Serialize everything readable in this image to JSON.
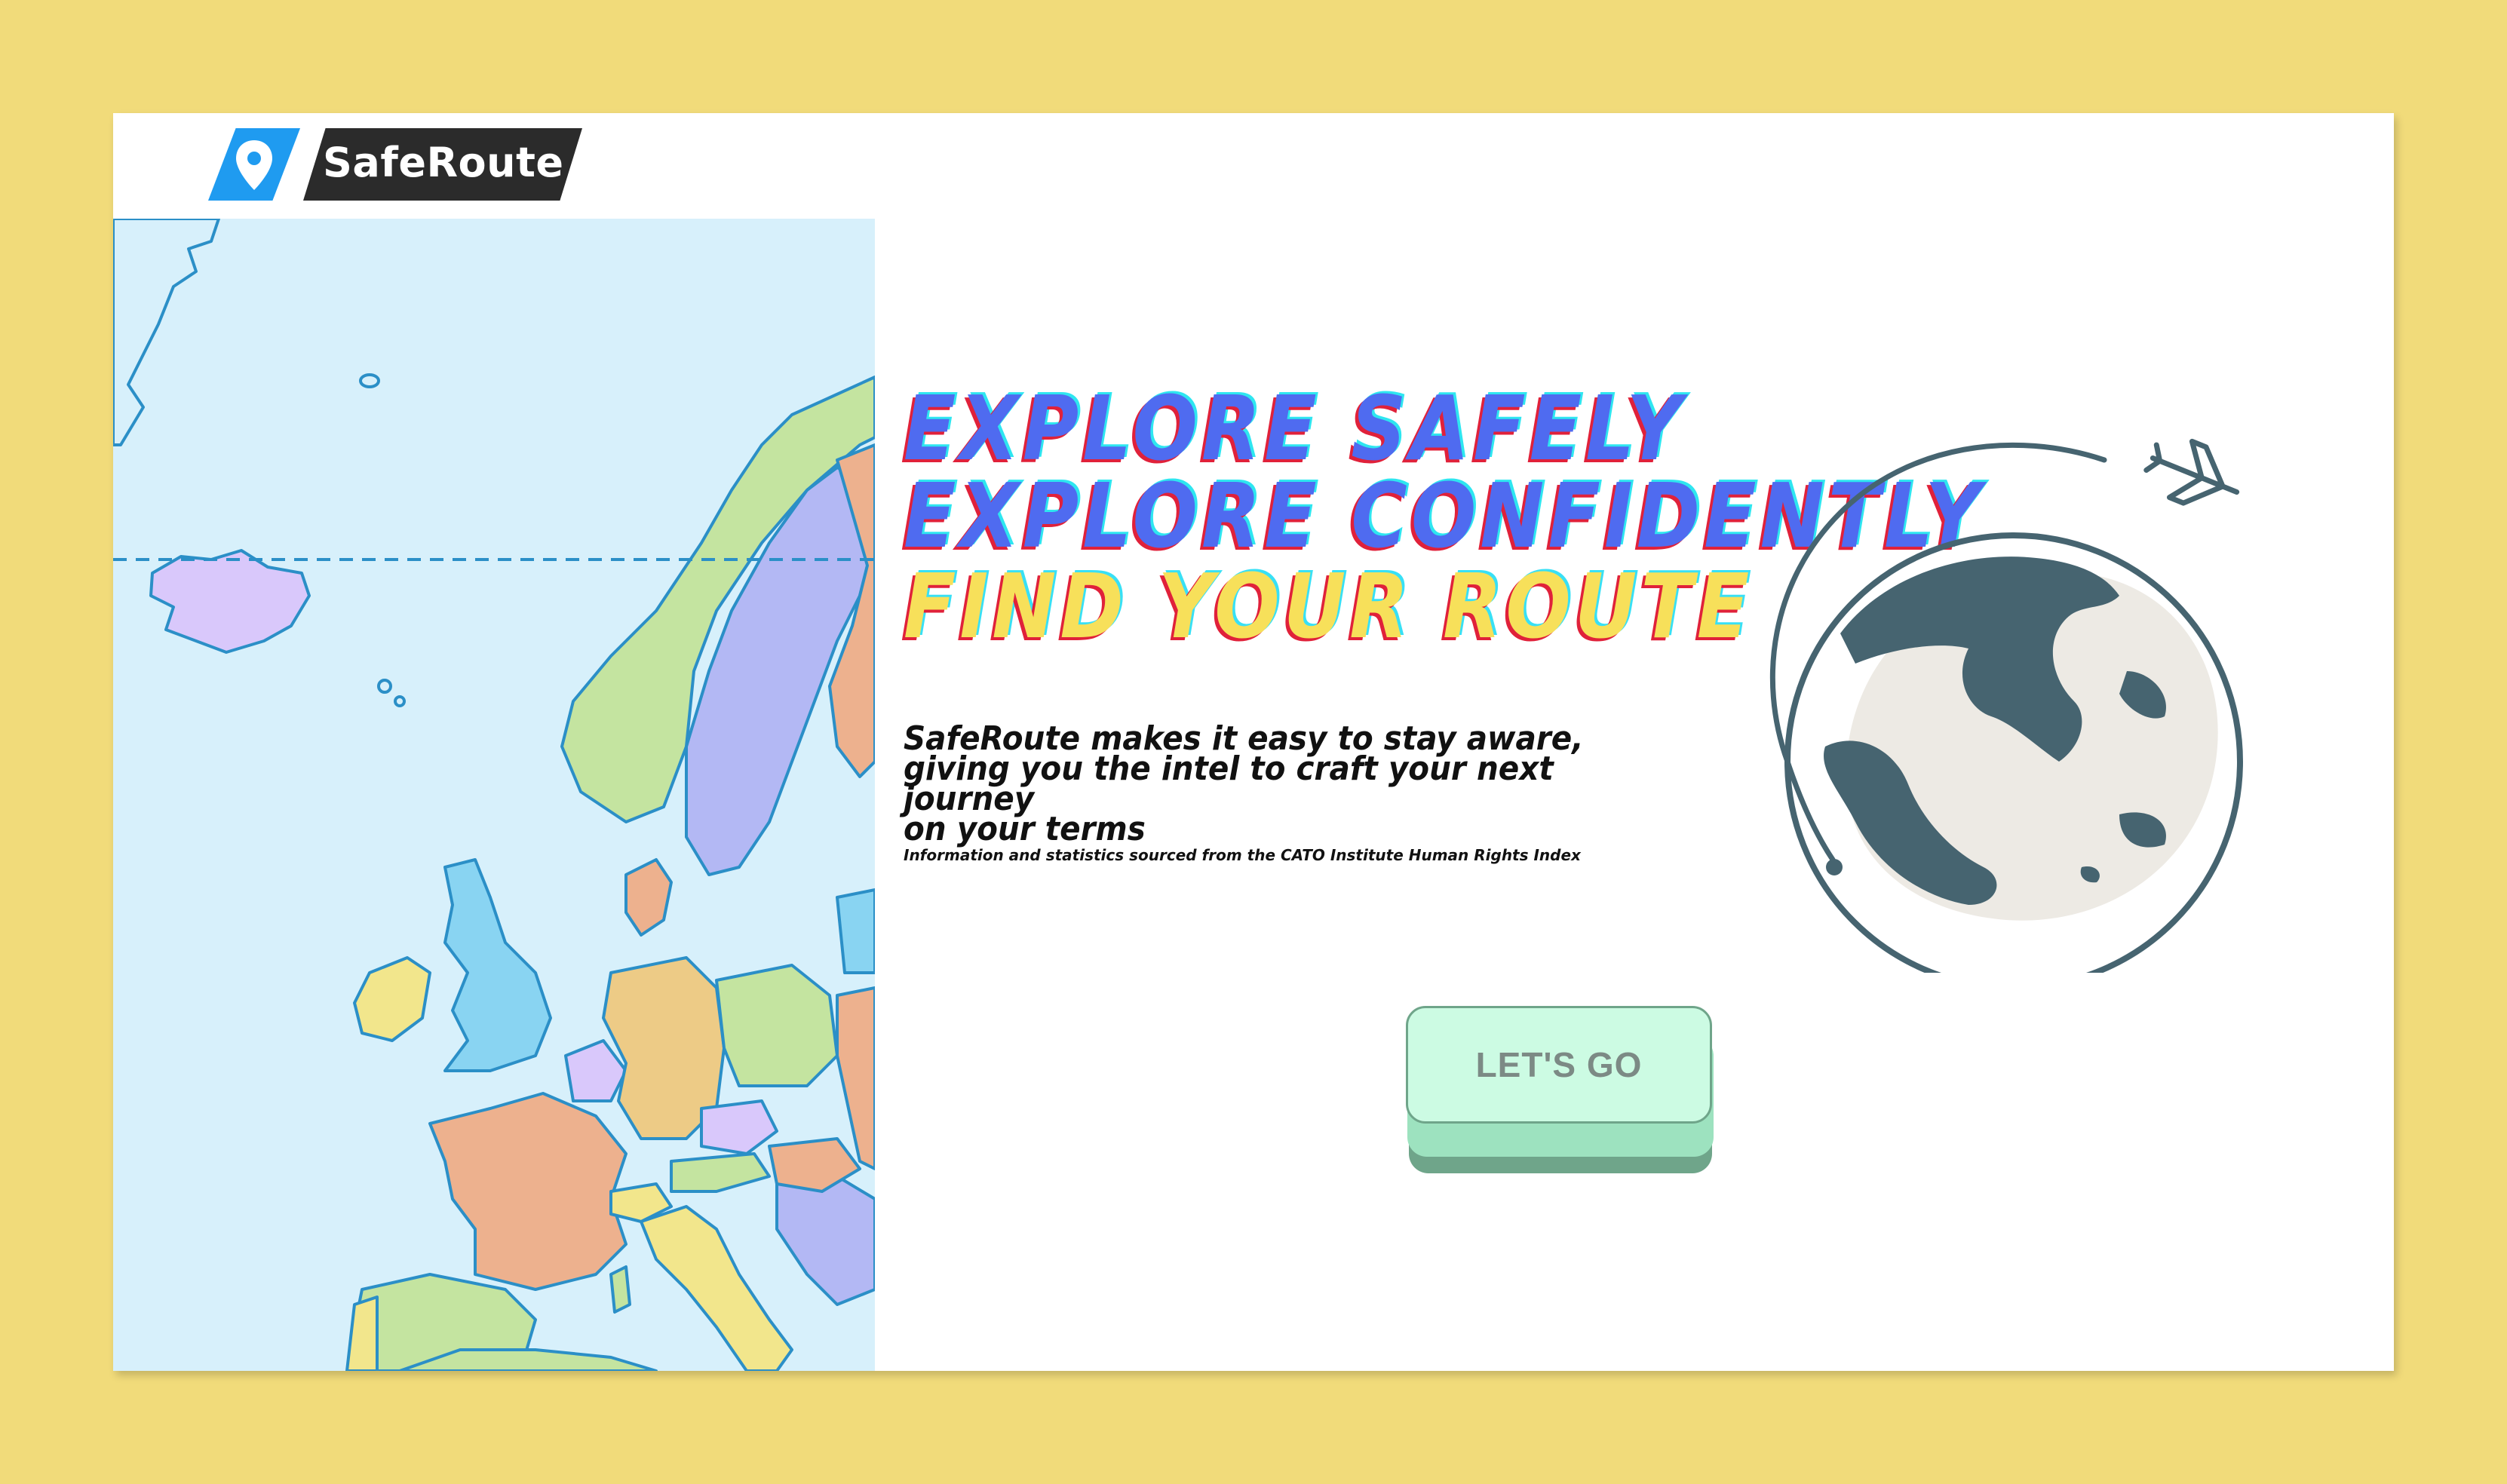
{
  "brand": {
    "name": "SafeRoute",
    "logo_icon": "location-pin-icon",
    "pin_color": "#1F9BF0",
    "bar_color": "#2B2B2B"
  },
  "hero": {
    "line1": "EXPLORE SAFELY",
    "line2": "EXPLORE CONFIDENTLY",
    "line3": "FIND YOUR ROUTE",
    "tagline_lines": [
      "SafeRoute makes it easy to stay aware,",
      "giving you the intel to craft your next journey",
      "on your terms"
    ],
    "source_note": "Information and statistics sourced from the CATO Institute Human Rights Index"
  },
  "cta": {
    "label": "LET'S GO"
  },
  "illustration": {
    "map": "europe-map",
    "globe": "globe-with-plane-icon"
  },
  "colors": {
    "page_background": "#F1DB7A",
    "card_background": "#FFFFFF",
    "headline_blue": "#4F6BF0",
    "headline_yellow": "#F7E05A",
    "button_fill": "#CCFBE3",
    "button_shadow": "#6FA58A",
    "globe_dark": "#466470",
    "globe_light": "#EDEAE4",
    "sea": "#D7F0FB"
  }
}
